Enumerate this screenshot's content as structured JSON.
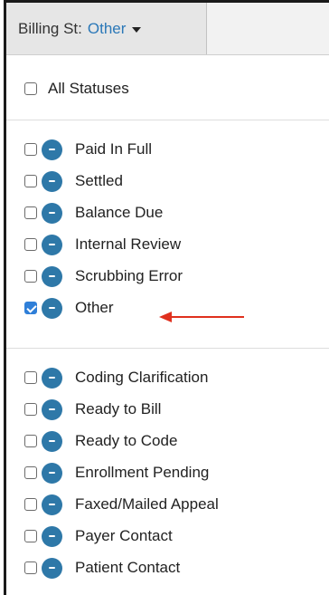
{
  "filter": {
    "label": "Billing St:",
    "value": "Other"
  },
  "all_statuses": {
    "label": "All Statuses",
    "checked": false
  },
  "groups": [
    {
      "items": [
        {
          "label": "Paid In Full",
          "checked": false
        },
        {
          "label": "Settled",
          "checked": false
        },
        {
          "label": "Balance Due",
          "checked": false
        },
        {
          "label": "Internal Review",
          "checked": false
        },
        {
          "label": "Scrubbing Error",
          "checked": false
        },
        {
          "label": "Other",
          "checked": true
        }
      ]
    },
    {
      "items": [
        {
          "label": "Coding Clarification",
          "checked": false
        },
        {
          "label": "Ready to Bill",
          "checked": false
        },
        {
          "label": "Ready to Code",
          "checked": false
        },
        {
          "label": "Enrollment Pending",
          "checked": false
        },
        {
          "label": "Faxed/Mailed Appeal",
          "checked": false
        },
        {
          "label": "Payer Contact",
          "checked": false
        },
        {
          "label": "Patient Contact",
          "checked": false
        }
      ]
    }
  ],
  "colors": {
    "accent": "#2e78a8",
    "link": "#2b78b8",
    "checkbox_checked": "#2f7fd8",
    "annotation_arrow": "#e0301e"
  },
  "icons": {
    "badge": "minus-circle-icon",
    "annotation": "red-arrow-icon"
  }
}
